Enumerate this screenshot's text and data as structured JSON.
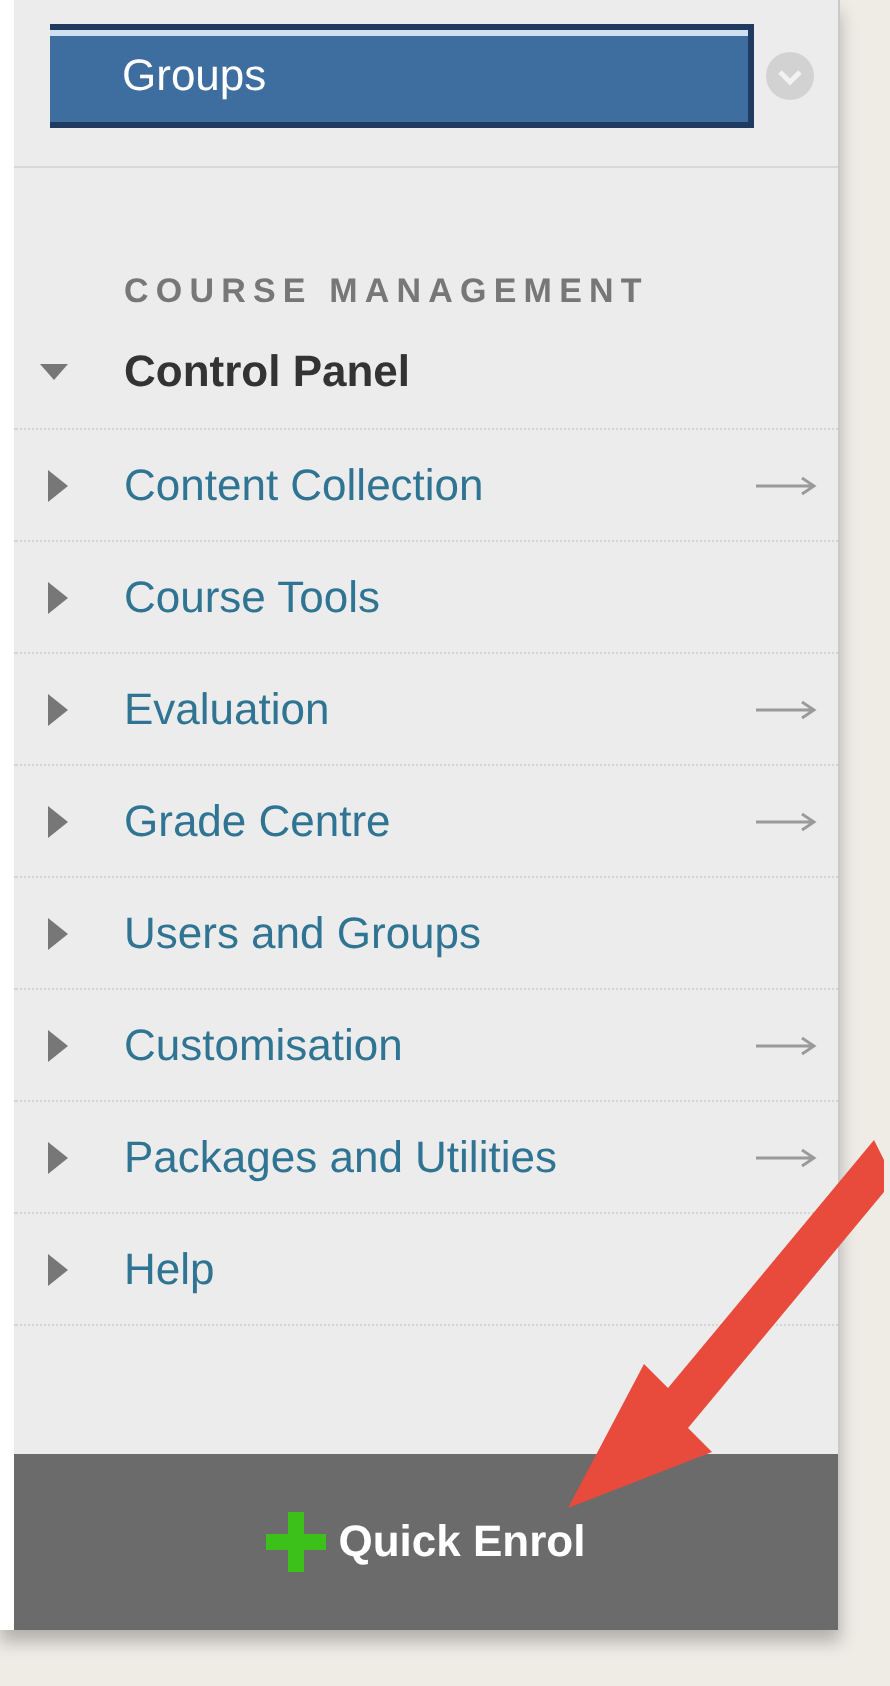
{
  "top_button": {
    "label": "Groups"
  },
  "section_heading": "COURSE MANAGEMENT",
  "control_panel": {
    "label": "Control Panel",
    "expanded": true,
    "items": [
      {
        "label": "Content Collection",
        "has_arrow": true
      },
      {
        "label": "Course Tools",
        "has_arrow": false
      },
      {
        "label": "Evaluation",
        "has_arrow": true
      },
      {
        "label": "Grade Centre",
        "has_arrow": true
      },
      {
        "label": "Users and Groups",
        "has_arrow": false
      },
      {
        "label": "Customisation",
        "has_arrow": true
      },
      {
        "label": "Packages and Utilities",
        "has_arrow": true
      },
      {
        "label": "Help",
        "has_arrow": false
      }
    ]
  },
  "quick_enrol": {
    "label": "Quick Enrol"
  }
}
